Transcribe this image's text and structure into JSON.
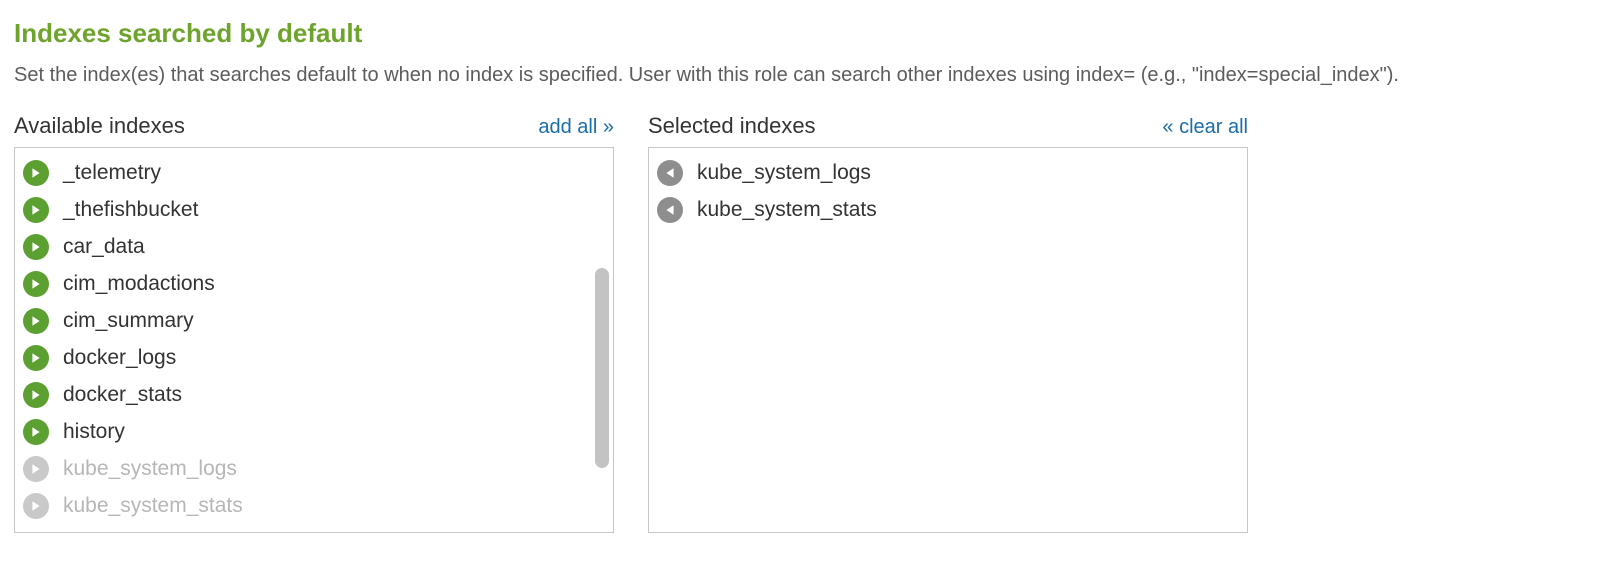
{
  "section": {
    "title": "Indexes searched by default",
    "description": "Set the index(es) that searches default to when no index is specified. User with this role can search other indexes using index= (e.g., \"index=special_index\")."
  },
  "available": {
    "title": "Available indexes",
    "action_label": "add all »",
    "items": [
      {
        "name": "_telemetry",
        "disabled": false
      },
      {
        "name": "_thefishbucket",
        "disabled": false
      },
      {
        "name": "car_data",
        "disabled": false
      },
      {
        "name": "cim_modactions",
        "disabled": false
      },
      {
        "name": "cim_summary",
        "disabled": false
      },
      {
        "name": "docker_logs",
        "disabled": false
      },
      {
        "name": "docker_stats",
        "disabled": false
      },
      {
        "name": "history",
        "disabled": false
      },
      {
        "name": "kube_system_logs",
        "disabled": true
      },
      {
        "name": "kube_system_stats",
        "disabled": true
      }
    ]
  },
  "selected": {
    "title": "Selected indexes",
    "action_label": "« clear all",
    "items": [
      {
        "name": "kube_system_logs"
      },
      {
        "name": "kube_system_stats"
      }
    ]
  }
}
